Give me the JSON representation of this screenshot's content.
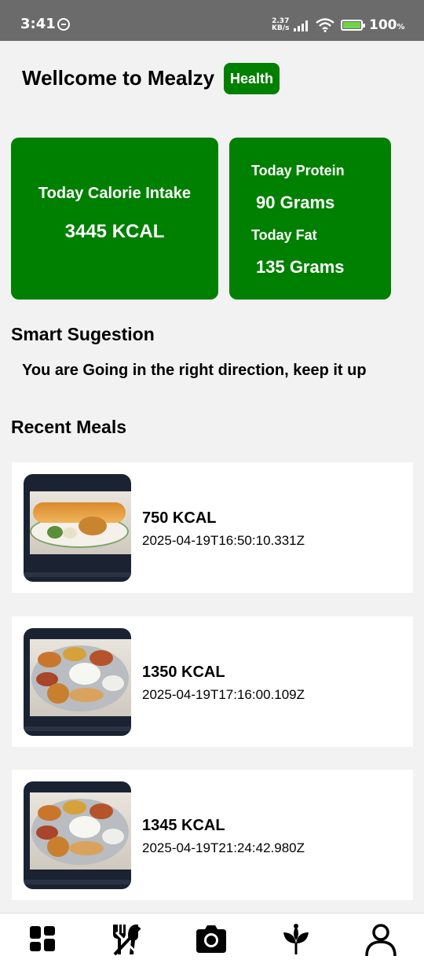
{
  "status_bar": {
    "time": "3:41",
    "net_speed_value": "2.37",
    "net_speed_unit": "KB/s",
    "battery_percent": "100",
    "battery_symbol": "%",
    "battery_level": 1.0
  },
  "header": {
    "title": "Wellcome to Mealzy",
    "badge": "Health"
  },
  "stats": {
    "calorie_label": "Today Calorie Intake",
    "calorie_value": "3445 KCAL",
    "protein_label": "Today Protein",
    "protein_value": "90 Grams",
    "fat_label": "Today Fat",
    "fat_value": "135 Grams"
  },
  "suggestion": {
    "heading": "Smart Sugestion",
    "text": "You are Going in the right direction, keep it up"
  },
  "recent": {
    "heading": "Recent Meals",
    "meals": [
      {
        "kcal": "750 KCAL",
        "timestamp": "2025-04-19T16:50:10.331Z",
        "photo_icon": "dosa-photo"
      },
      {
        "kcal": "1350 KCAL",
        "timestamp": "2025-04-19T17:16:00.109Z",
        "photo_icon": "thali-photo"
      },
      {
        "kcal": "1345 KCAL",
        "timestamp": "2025-04-19T21:24:42.980Z",
        "photo_icon": "thali-photo"
      }
    ]
  },
  "bottom_nav": [
    {
      "icon": "dashboard-icon"
    },
    {
      "icon": "utensils-icon"
    },
    {
      "icon": "camera-icon"
    },
    {
      "icon": "plant-icon"
    },
    {
      "icon": "user-icon"
    }
  ],
  "colors": {
    "accent": "#008000",
    "background": "#f2f2f2",
    "status_bar": "#6b6b6b"
  }
}
